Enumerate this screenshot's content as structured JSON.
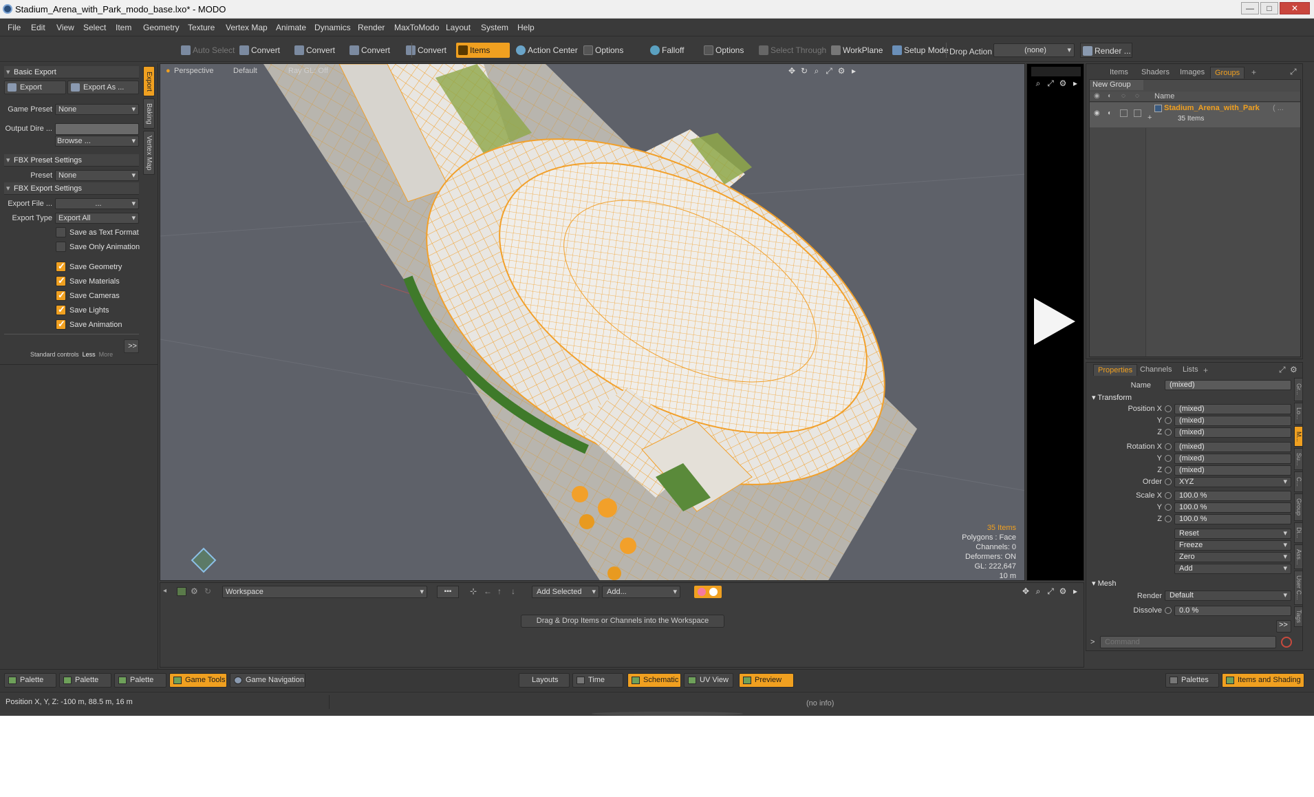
{
  "window": {
    "title": "Stadium_Arena_with_Park_modo_base.lxo* - MODO",
    "minimize": "—",
    "maximize": "□",
    "close": "✕"
  },
  "menu": [
    "File",
    "Edit",
    "View",
    "Select",
    "Item",
    "Geometry",
    "Texture",
    "Vertex Map",
    "Animate",
    "Dynamics",
    "Render",
    "MaxToModo",
    "Layout",
    "System",
    "Help"
  ],
  "toolbar": {
    "auto_select": "Auto Select",
    "convert1": "Convert",
    "convert2": "Convert",
    "convert3": "Convert",
    "convert4": "Convert",
    "items": "Items",
    "action_center": "Action Center",
    "options1": "Options",
    "falloff": "Falloff",
    "options2": "Options",
    "select_through": "Select Through",
    "workplane": "WorkPlane",
    "setup_mode": "Setup Mode",
    "drop_action_label": "Drop Action",
    "drop_action_value": "(none)",
    "render": "Render ..."
  },
  "left_panel": {
    "basic_export": "Basic Export",
    "export_btn": "Export",
    "export_as_btn": "Export As ...",
    "game_preset_label": "Game Preset",
    "game_preset_value": "None",
    "output_dir_label": "Output Dire ...",
    "browse": "Browse ...",
    "fbx_preset_settings": "FBX Preset Settings",
    "preset_label": "Preset",
    "preset_value": "None",
    "fbx_export_settings": "FBX Export Settings",
    "export_file_label": "Export File ...",
    "export_file_value": "...",
    "export_type_label": "Export Type",
    "export_type_value": "Export All",
    "options": [
      {
        "label": "Save as Text Format",
        "checked": false
      },
      {
        "label": "Save Only Animation",
        "checked": false
      },
      {
        "label": "Save Geometry",
        "checked": true
      },
      {
        "label": "Save Materials",
        "checked": true
      },
      {
        "label": "Save Cameras",
        "checked": true
      },
      {
        "label": "Save Lights",
        "checked": true
      },
      {
        "label": "Save Animation",
        "checked": true
      }
    ],
    "more_btn": ">>",
    "standard_controls": "Standard controls",
    "less": "Less",
    "more": "More",
    "vtabs": [
      "Export",
      "Baking",
      "Vertex Map"
    ]
  },
  "viewport": {
    "perspective": "Perspective",
    "default": "Default",
    "ray_gl": "Ray GL: Off",
    "info": {
      "items": "35 Items",
      "polygons": "Polygons : Face",
      "channels": "Channels: 0",
      "deformers": "Deformers: ON",
      "gl": "GL: 222,647",
      "scale": "10 m"
    }
  },
  "groups_panel": {
    "tabs": [
      "Items",
      "Shaders",
      "Images",
      "Groups"
    ],
    "active_tab": "Groups",
    "new_group": "New Group",
    "name_header": "Name",
    "group_name": "Stadium_Arena_with_Park",
    "group_suffix": "( ...",
    "group_count": "35 Items"
  },
  "properties": {
    "tabs": [
      "Properties",
      "Channels",
      "Lists"
    ],
    "name_label": "Name",
    "name_value": "(mixed)",
    "transform": "Transform",
    "position_x_label": "Position X",
    "rotation_x_label": "Rotation X",
    "scale_x_label": "Scale X",
    "y_label": "Y",
    "z_label": "Z",
    "mixed": "(mixed)",
    "order_label": "Order",
    "order_value": "XYZ",
    "scale_value": "100.0 %",
    "reset": "Reset",
    "freeze": "Freeze",
    "zero": "Zero",
    "add": "Add",
    "mesh": "Mesh",
    "render_label": "Render",
    "render_value": "Default",
    "dissolve_label": "Dissolve",
    "dissolve_value": "0.0 %",
    "more": ">>",
    "command_placeholder": "Command",
    "side_tabs": [
      "Gr...",
      "Lo...",
      "M...",
      "Su...",
      "C...",
      "Group",
      "Di...",
      "Ass...",
      "User C...",
      "Tags"
    ]
  },
  "schematic": {
    "workspace": "Workspace",
    "add_selected": "Add Selected",
    "add": "Add...",
    "hint": "Drag & Drop Items or Channels into the Workspace"
  },
  "palette_bar": {
    "palette1": "Palette",
    "palette2": "Palette",
    "palette3": "Palette",
    "game_tools": "Game Tools",
    "game_navigation": "Game Navigation",
    "layouts": "Layouts",
    "time": "Time",
    "schematic": "Schematic",
    "uv_view": "UV View",
    "preview": "Preview",
    "palettes": "Palettes",
    "items_and_shading": "Items and Shading"
  },
  "status": {
    "position": "Position X, Y, Z:  -100 m, 88.5 m, 16 m",
    "info": "(no info)"
  },
  "colors": {
    "accent": "#f0a020",
    "panel": "#3c3c3c",
    "viewport": "#5e6169",
    "wire": "#f2a02a"
  }
}
